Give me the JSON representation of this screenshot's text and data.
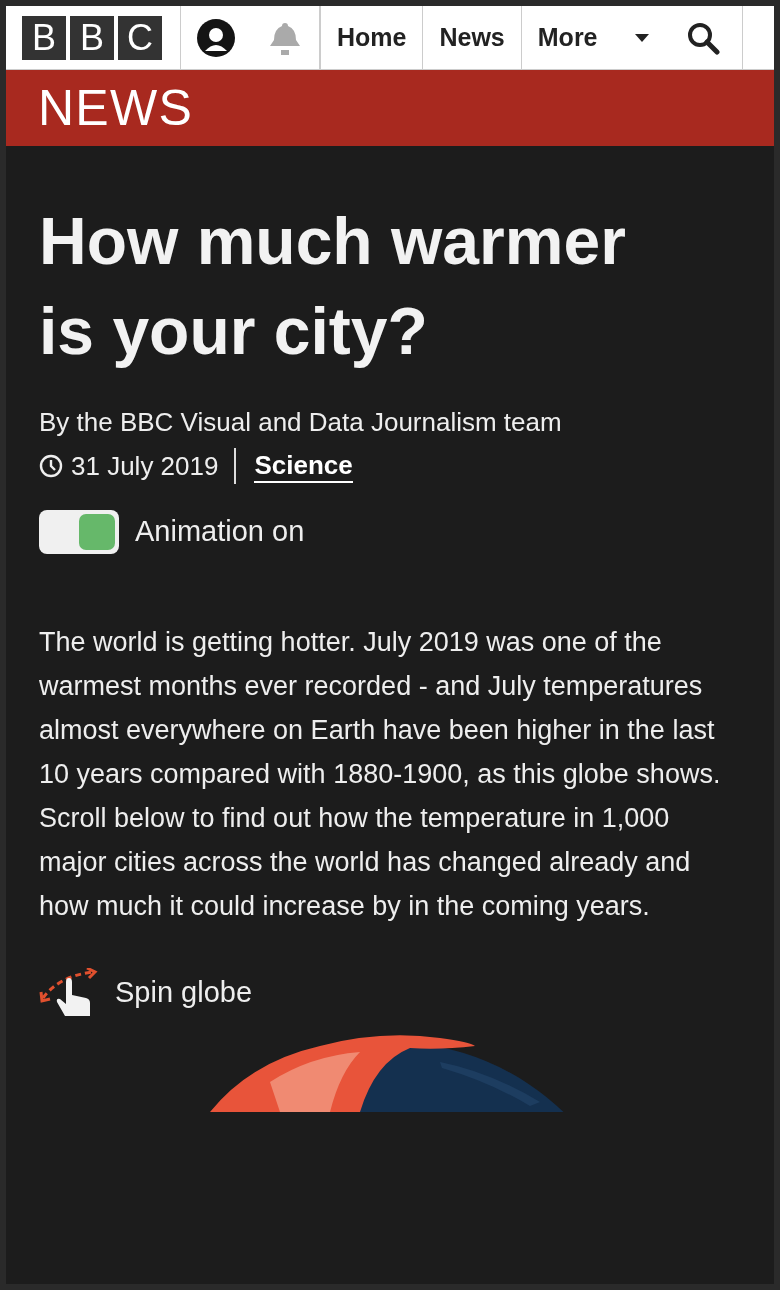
{
  "masthead": {
    "logo": [
      "B",
      "B",
      "C"
    ],
    "nav": [
      {
        "label": "Home"
      },
      {
        "label": "News"
      },
      {
        "label": "More"
      }
    ]
  },
  "section_banner": {
    "title": "NEWS"
  },
  "article": {
    "headline": "How much warmer is your city?",
    "byline": "By the BBC Visual and Data Journalism team",
    "date": "31 July 2019",
    "topic": "Science",
    "animation_toggle": {
      "label": "Animation on",
      "on": true
    },
    "intro": "The world is getting hotter. July 2019 was one of the warmest months ever recorded - and July temperatures almost everywhere on Earth have been higher in the last 10 years compared with 1880-1900, as this globe shows. Scroll below to find out how the temperature in 1,000 major cities across the world has changed already and how much it could increase by in the coming years.",
    "spin_hint": "Spin globe"
  }
}
